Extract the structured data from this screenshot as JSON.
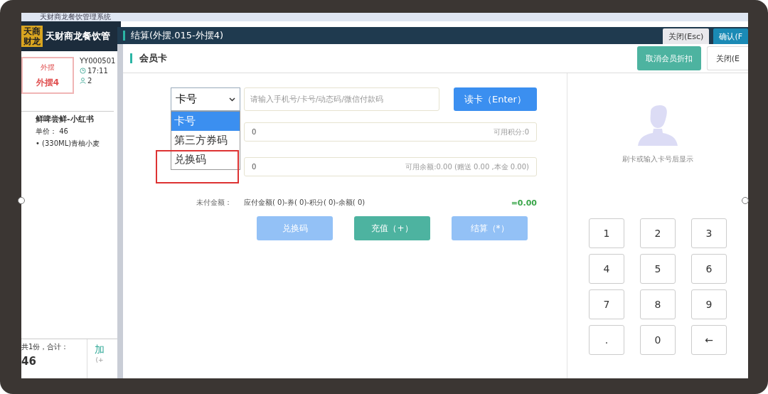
{
  "app": {
    "title": "天财商龙餐饮管理系统",
    "logo": "天商财龙",
    "brand": "天财商龙餐饮管"
  },
  "left_panel": {
    "table_area": "外摆",
    "table_name": "外摆4",
    "order_no": "YY000501",
    "time": "17:11",
    "guests": "2",
    "items": [
      {
        "name": "鲜啤尝鲜-小红书",
        "price": "单价： 46",
        "option": "• (330ML)青柚小麦"
      }
    ],
    "total_label": "共1份，合计：",
    "total": "46",
    "add_button": "加",
    "add_hint": "(+"
  },
  "settlement": {
    "title": "结算(外摆.015-外摆4)",
    "buttons": [
      {
        "label": "关闭(Esc)",
        "kind": "plain"
      },
      {
        "label": "确认(F",
        "kind": "primary"
      }
    ]
  },
  "member_card": {
    "title": "会员卡",
    "header_buttons": [
      {
        "label": "取消会员折扣",
        "kind": "teal"
      },
      {
        "label": "关闭(E",
        "kind": "plain"
      }
    ],
    "select": {
      "value": "卡号",
      "expanded": true,
      "options": [
        {
          "label": "卡号",
          "selected": true
        },
        {
          "label": "第三方券码",
          "selected": false
        },
        {
          "label": "兑换码",
          "selected": false
        }
      ]
    },
    "search": {
      "placeholder": "请输入手机号/卡号/动态码/微信付款码"
    },
    "read_button": "读卡（Enter）",
    "fields": [
      {
        "value": "0",
        "hint": "可用积分:0"
      },
      {
        "value": "0",
        "hint": "可用余额:0.00 (赠送 0.00 ,本金 0.00)"
      }
    ],
    "unpaid_label": "未付金额：",
    "formula": "应付金额( 0)-券( 0)-积分( 0)-余额( 0)",
    "result": "=0.00",
    "actions": [
      {
        "label": "兑换码",
        "kind": "blue",
        "disabled": true
      },
      {
        "label": "充值（+）",
        "kind": "teal",
        "disabled": false
      },
      {
        "label": "结算（*）",
        "kind": "blue",
        "disabled": true
      }
    ],
    "avatar_hint": "刷卡或输入卡号后显示",
    "keypad": [
      "1",
      "2",
      "3",
      "4",
      "5",
      "6",
      "7",
      "8",
      "9",
      ".",
      "0",
      "←"
    ]
  }
}
